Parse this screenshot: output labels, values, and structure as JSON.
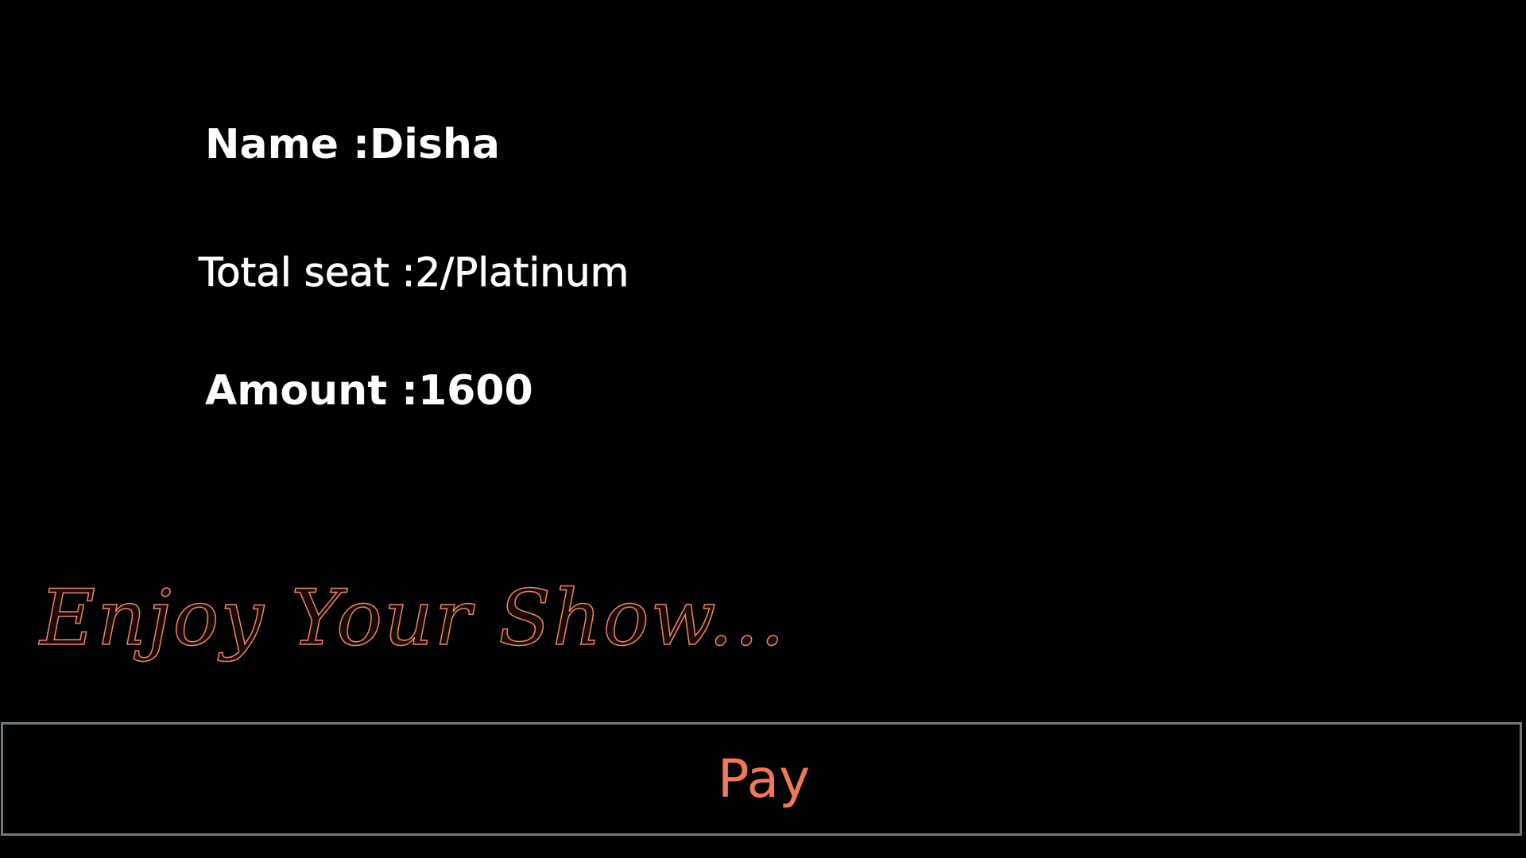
{
  "booking": {
    "name_line": "Name :Disha",
    "seat_line": "Total seat :2/Platinum",
    "amount_line": "Amount :1600"
  },
  "tagline": "Enjoy Your Show...",
  "pay_button": {
    "label": "Pay"
  },
  "colors": {
    "background": "#000000",
    "text": "#ffffff",
    "accent": "#f07a55",
    "button_border": "#6f7780"
  }
}
